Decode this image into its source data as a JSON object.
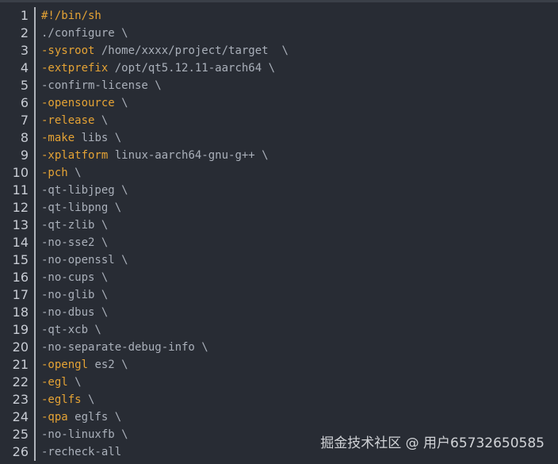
{
  "lines": [
    {
      "n": "1",
      "kw": "#!/bin/sh",
      "rest": ""
    },
    {
      "n": "2",
      "kw": "",
      "rest": "./configure \\"
    },
    {
      "n": "3",
      "kw": "-sysroot",
      "rest": " /home/xxxx/project/target  \\"
    },
    {
      "n": "4",
      "kw": "-extprefix",
      "rest": " /opt/qt5.12.11-aarch64 \\"
    },
    {
      "n": "5",
      "kw": "",
      "rest": "-confirm-license \\"
    },
    {
      "n": "6",
      "kw": "-opensource",
      "rest": " \\"
    },
    {
      "n": "7",
      "kw": "-release",
      "rest": " \\"
    },
    {
      "n": "8",
      "kw": "-make",
      "rest": " libs \\"
    },
    {
      "n": "9",
      "kw": "-xplatform",
      "rest": " linux-aarch64-gnu-g++ \\"
    },
    {
      "n": "10",
      "kw": "-pch",
      "rest": " \\"
    },
    {
      "n": "11",
      "kw": "",
      "rest": "-qt-libjpeg \\"
    },
    {
      "n": "12",
      "kw": "",
      "rest": "-qt-libpng \\"
    },
    {
      "n": "13",
      "kw": "",
      "rest": "-qt-zlib \\"
    },
    {
      "n": "14",
      "kw": "",
      "rest": "-no-sse2 \\"
    },
    {
      "n": "15",
      "kw": "",
      "rest": "-no-openssl \\"
    },
    {
      "n": "16",
      "kw": "",
      "rest": "-no-cups \\"
    },
    {
      "n": "17",
      "kw": "",
      "rest": "-no-glib \\"
    },
    {
      "n": "18",
      "kw": "",
      "rest": "-no-dbus \\"
    },
    {
      "n": "19",
      "kw": "",
      "rest": "-qt-xcb \\"
    },
    {
      "n": "20",
      "kw": "",
      "rest": "-no-separate-debug-info \\"
    },
    {
      "n": "21",
      "kw": "-opengl",
      "rest": " es2 \\"
    },
    {
      "n": "22",
      "kw": "-egl",
      "rest": " \\"
    },
    {
      "n": "23",
      "kw": "-eglfs",
      "rest": " \\"
    },
    {
      "n": "24",
      "kw": "-qpa",
      "rest": " eglfs \\"
    },
    {
      "n": "25",
      "kw": "",
      "rest": "-no-linuxfb \\"
    },
    {
      "n": "26",
      "kw": "",
      "rest": "-recheck-all"
    }
  ],
  "watermark": "掘金技术社区 @ 用户65732650585",
  "colors": {
    "background": "#282c34",
    "keyword": "#e5a335",
    "text": "#aab0ba"
  }
}
